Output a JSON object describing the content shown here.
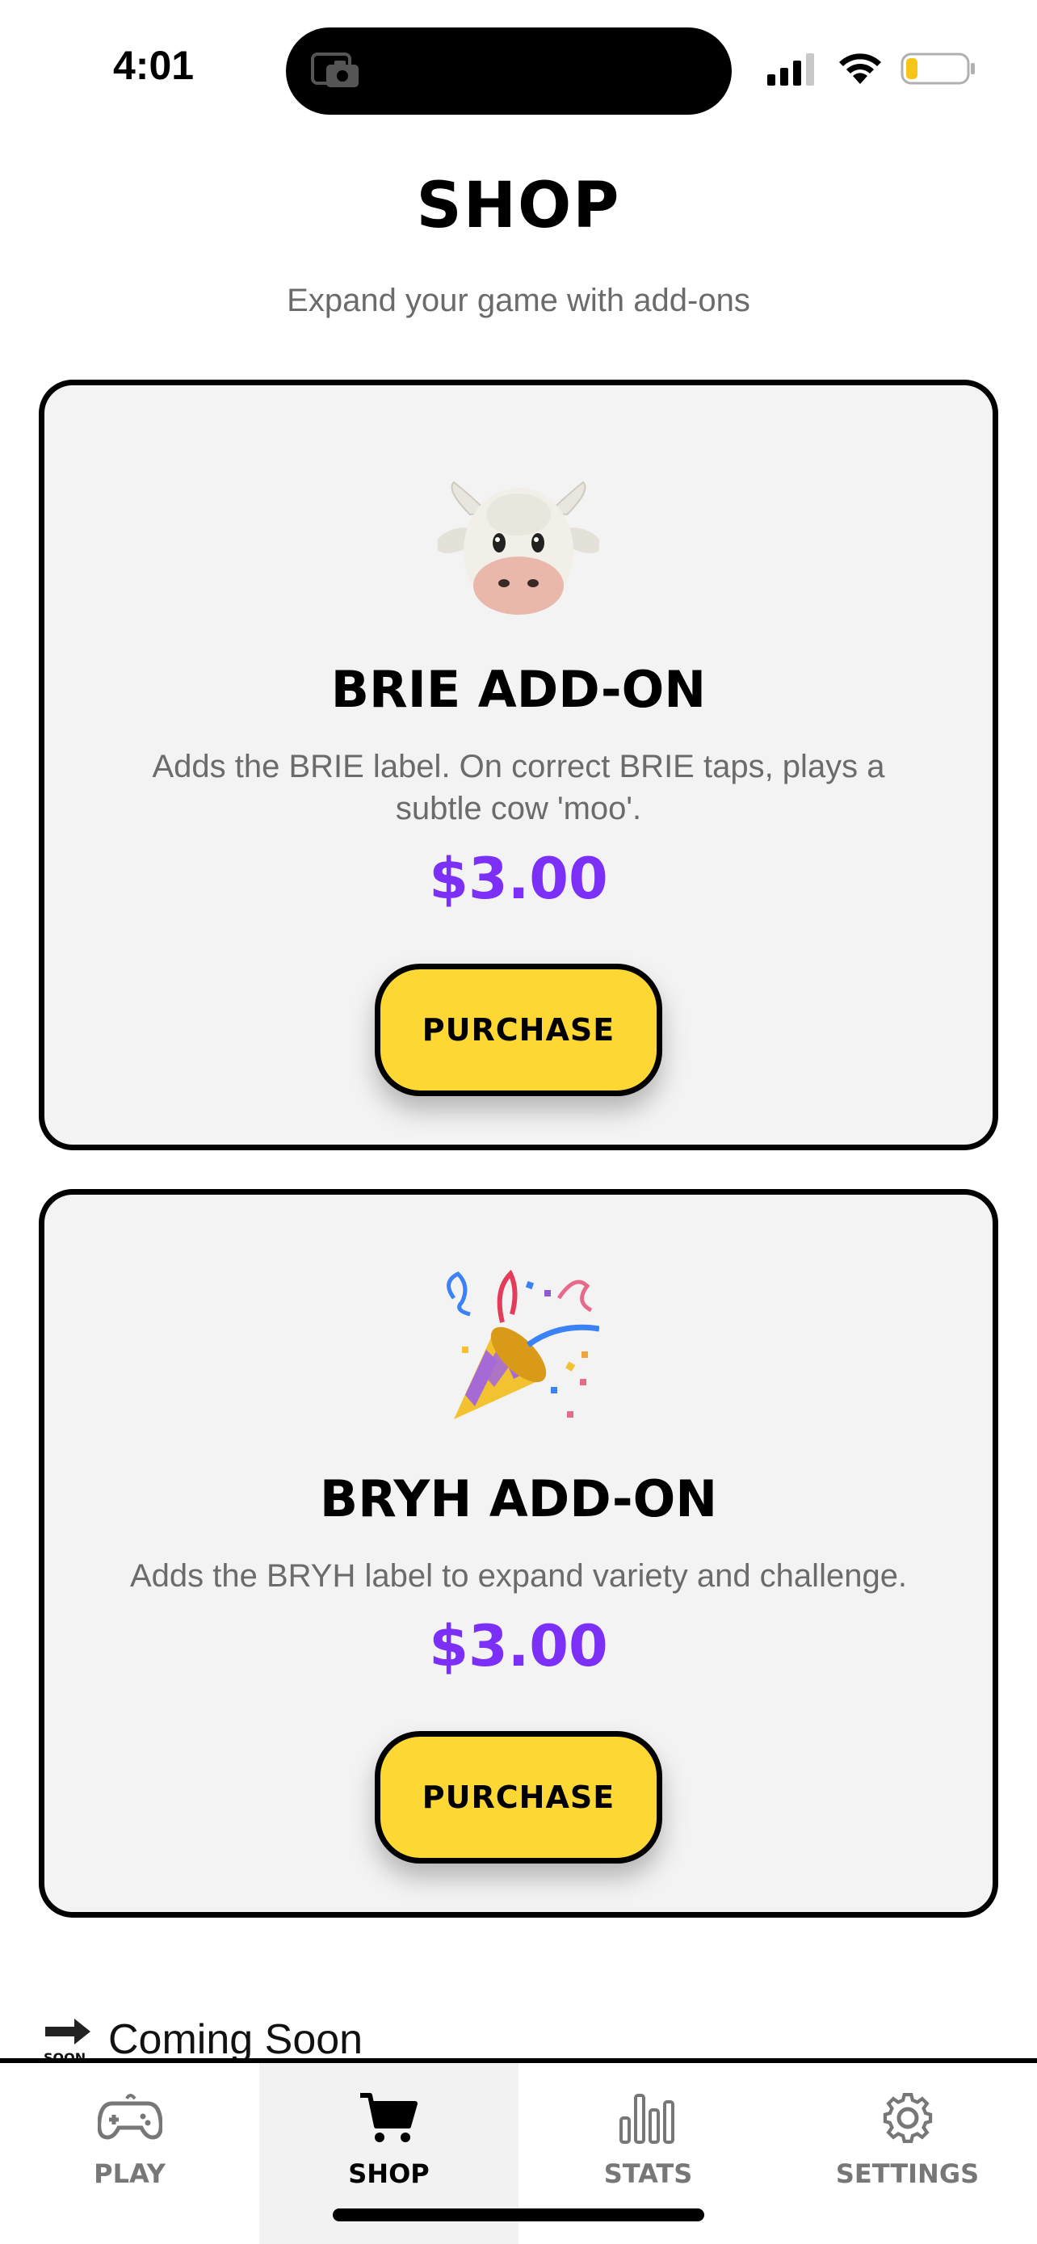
{
  "status_bar": {
    "time": "4:01"
  },
  "header": {
    "title": "SHOP",
    "subtitle": "Expand your game with add-ons"
  },
  "products": [
    {
      "emoji": "cow-face",
      "title": "BRIE ADD-ON",
      "description": "Adds the BRIE label. On correct BRIE taps, plays a subtle cow 'moo'.",
      "price": "$3.00",
      "button_label": "PURCHASE"
    },
    {
      "emoji": "party-popper",
      "title": "BRYH ADD-ON",
      "description": "Adds the BRYH label to expand variety and challenge.",
      "price": "$3.00",
      "button_label": "PURCHASE"
    }
  ],
  "coming_soon": {
    "icon_text": "SOON",
    "label": "Coming Soon"
  },
  "tab_bar": {
    "tabs": [
      {
        "label": "PLAY",
        "icon": "gamepad-icon"
      },
      {
        "label": "SHOP",
        "icon": "cart-icon",
        "active": true
      },
      {
        "label": "STATS",
        "icon": "bar-chart-icon"
      },
      {
        "label": "SETTINGS",
        "icon": "gear-icon"
      }
    ]
  },
  "colors": {
    "accent_yellow": "#fdd835",
    "price_purple": "#7b2ff7",
    "card_bg": "#f3f3f3",
    "border": "#000000"
  }
}
